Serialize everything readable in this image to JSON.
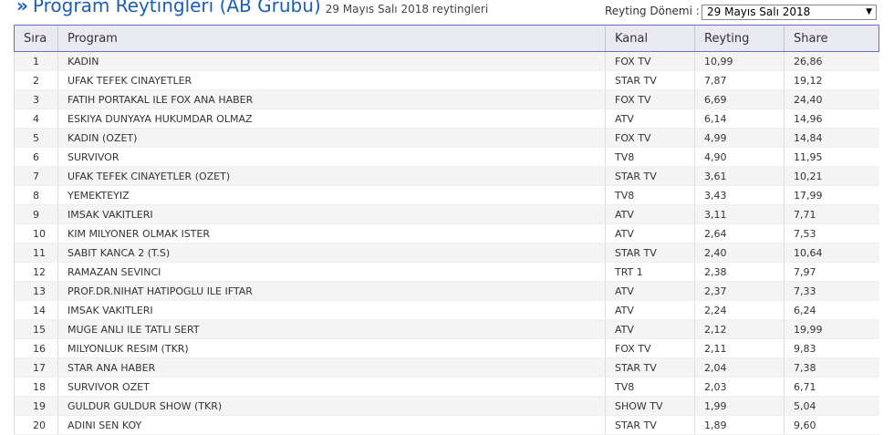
{
  "header": {
    "chevron": "»",
    "title": "Program Reytingleri (AB Grubu)",
    "subtitle": "29 Mayıs Salı 2018 reytingleri",
    "period_label": "Reyting Dönemi :",
    "period_value": "29 Mayıs Salı 2018",
    "dropdown_icon": "chevron-down-icon"
  },
  "table": {
    "columns": {
      "rank": "Sıra",
      "program": "Program",
      "channel": "Kanal",
      "rating": "Reyting",
      "share": "Share"
    },
    "rows": [
      {
        "rank": "1",
        "program": "KADIN",
        "channel": "FOX TV",
        "rating": "10,99",
        "share": "26,86"
      },
      {
        "rank": "2",
        "program": "UFAK TEFEK CINAYETLER",
        "channel": "STAR TV",
        "rating": "7,87",
        "share": "19,12"
      },
      {
        "rank": "3",
        "program": "FATIH PORTAKAL ILE FOX ANA HABER",
        "channel": "FOX TV",
        "rating": "6,69",
        "share": "24,40"
      },
      {
        "rank": "4",
        "program": "ESKIYA DUNYAYA HUKUMDAR OLMAZ",
        "channel": "ATV",
        "rating": "6,14",
        "share": "14,96"
      },
      {
        "rank": "5",
        "program": "KADIN (OZET)",
        "channel": "FOX TV",
        "rating": "4,99",
        "share": "14,84"
      },
      {
        "rank": "6",
        "program": "SURVIVOR",
        "channel": "TV8",
        "rating": "4,90",
        "share": "11,95"
      },
      {
        "rank": "7",
        "program": "UFAK TEFEK CINAYETLER (OZET)",
        "channel": "STAR TV",
        "rating": "3,61",
        "share": "10,21"
      },
      {
        "rank": "8",
        "program": "YEMEKTEYIZ",
        "channel": "TV8",
        "rating": "3,43",
        "share": "17,99"
      },
      {
        "rank": "9",
        "program": "IMSAK VAKITLERI",
        "channel": "ATV",
        "rating": "3,11",
        "share": "7,71"
      },
      {
        "rank": "10",
        "program": "KIM MILYONER OLMAK ISTER",
        "channel": "ATV",
        "rating": "2,64",
        "share": "7,53"
      },
      {
        "rank": "11",
        "program": "SABIT KANCA 2 (T.S)",
        "channel": "STAR TV",
        "rating": "2,40",
        "share": "10,64"
      },
      {
        "rank": "12",
        "program": "RAMAZAN SEVINCI",
        "channel": "TRT 1",
        "rating": "2,38",
        "share": "7,97"
      },
      {
        "rank": "13",
        "program": "PROF.DR.NIHAT HATIPOGLU ILE IFTAR",
        "channel": "ATV",
        "rating": "2,37",
        "share": "7,33"
      },
      {
        "rank": "14",
        "program": "IMSAK VAKITLERI",
        "channel": "ATV",
        "rating": "2,24",
        "share": "6,24"
      },
      {
        "rank": "15",
        "program": "MUGE ANLI ILE TATLI SERT",
        "channel": "ATV",
        "rating": "2,12",
        "share": "19,99"
      },
      {
        "rank": "16",
        "program": "MILYONLUK RESIM (TKR)",
        "channel": "FOX TV",
        "rating": "2,11",
        "share": "9,83"
      },
      {
        "rank": "17",
        "program": "STAR ANA HABER",
        "channel": "STAR TV",
        "rating": "2,04",
        "share": "7,38"
      },
      {
        "rank": "18",
        "program": "SURVIVOR OZET",
        "channel": "TV8",
        "rating": "2,03",
        "share": "6,71"
      },
      {
        "rank": "19",
        "program": "GULDUR GULDUR SHOW (TKR)",
        "channel": "SHOW TV",
        "rating": "1,99",
        "share": "5,04"
      },
      {
        "rank": "20",
        "program": "ADINI SEN KOY",
        "channel": "STAR TV",
        "rating": "1,89",
        "share": "9,60"
      }
    ]
  }
}
